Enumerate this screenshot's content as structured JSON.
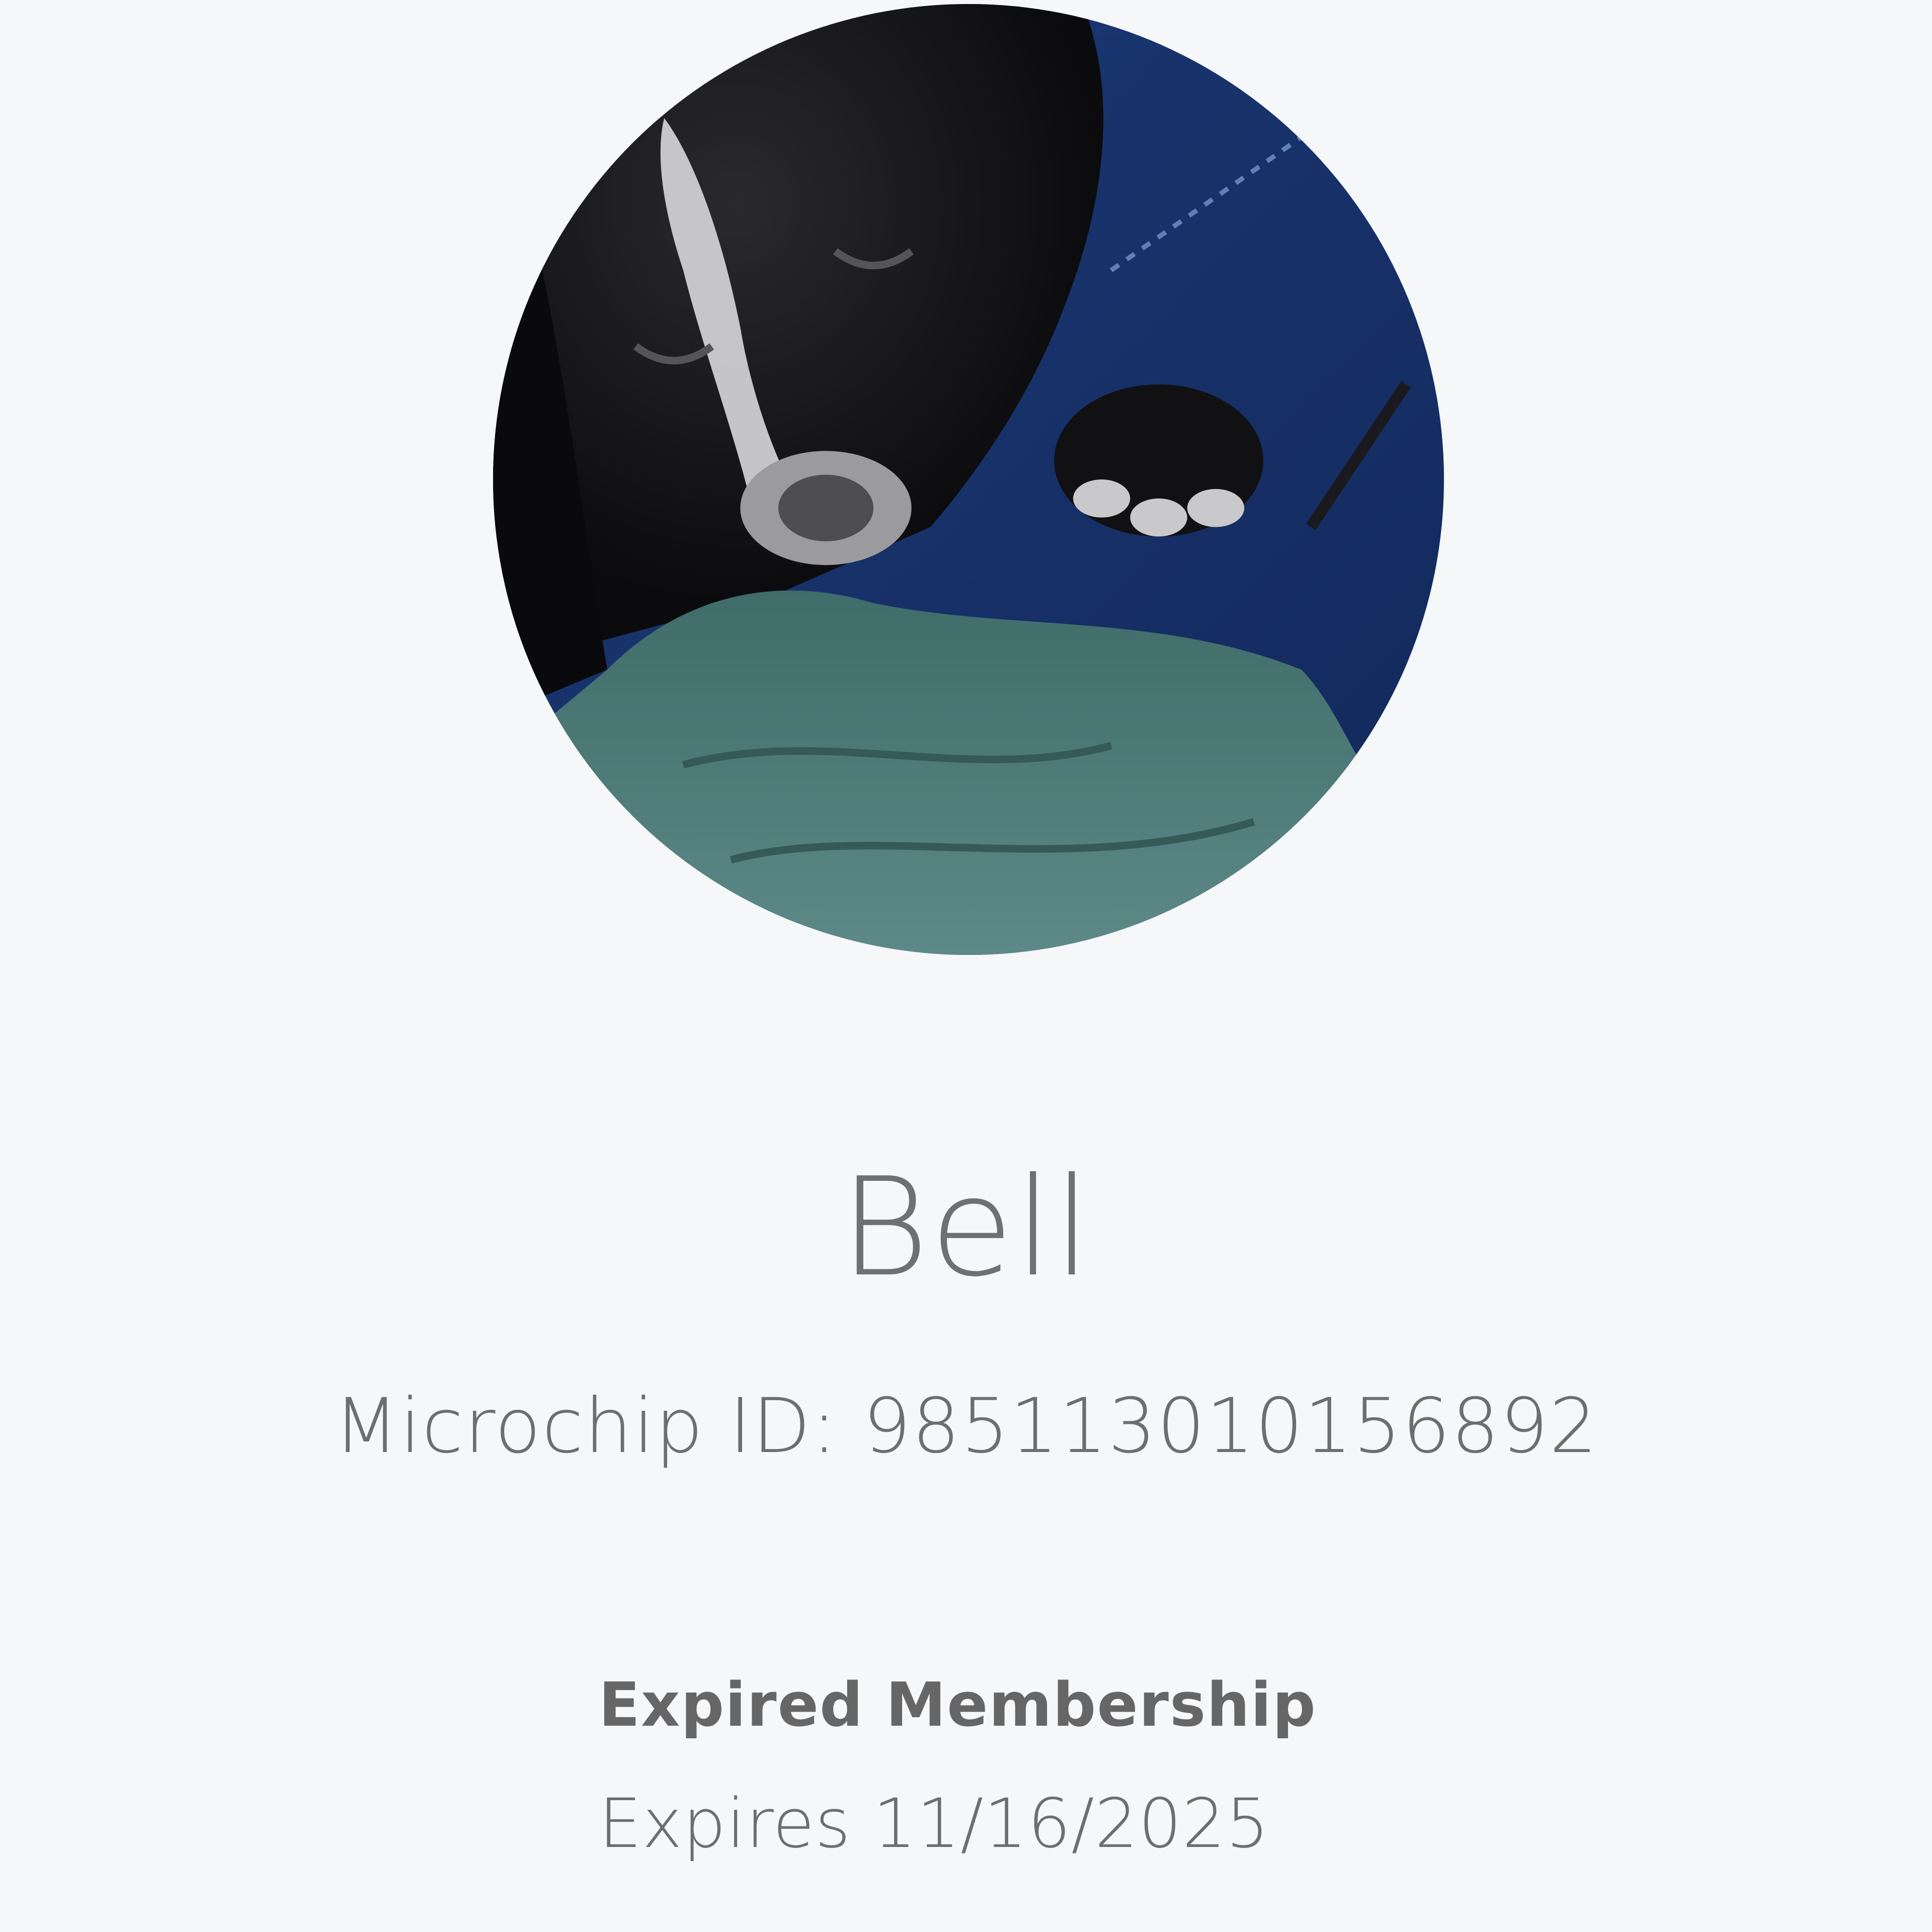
{
  "pet": {
    "name": "Bell",
    "microchip_text": "Microchip ID: 985113010156892",
    "photo_icon": "pet-photo"
  },
  "membership": {
    "status": "Expired Membership",
    "expiry_text": "Expires 11/16/2025"
  },
  "colors": {
    "background": "#f5f7f9",
    "text": "#6e6e6e"
  }
}
